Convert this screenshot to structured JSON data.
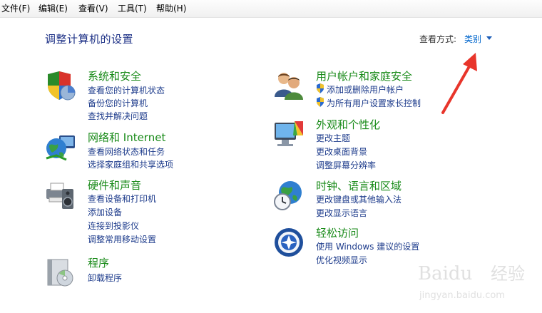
{
  "menu": {
    "file": "文件(F)",
    "edit": "编辑(E)",
    "view": "查看(V)",
    "tools": "工具(T)",
    "help": "帮助(H)"
  },
  "page": {
    "title": "调整计算机的设置",
    "view_by_label": "查看方式:",
    "view_by_value": "类别"
  },
  "categories": {
    "system": {
      "title": "系统和安全",
      "icon": "shield-chart-icon",
      "links": [
        "查看您的计算机状态",
        "备份您的计算机",
        "查找并解决问题"
      ]
    },
    "network": {
      "title": "网络和 Internet",
      "icon": "globe-network-icon",
      "links": [
        "查看网络状态和任务",
        "选择家庭组和共享选项"
      ]
    },
    "hardware": {
      "title": "硬件和声音",
      "icon": "printer-speaker-icon",
      "links": [
        "查看设备和打印机",
        "添加设备",
        "连接到投影仪",
        "调整常用移动设置"
      ]
    },
    "programs": {
      "title": "程序",
      "icon": "programs-disc-icon",
      "links": [
        "卸载程序"
      ]
    },
    "users": {
      "title": "用户帐户和家庭安全",
      "icon": "users-icon",
      "links": [
        "添加或删除用户帐户",
        "为所有用户设置家长控制"
      ]
    },
    "appearance": {
      "title": "外观和个性化",
      "icon": "monitor-paint-icon",
      "links": [
        "更改主题",
        "更改桌面背景",
        "调整屏幕分辨率"
      ]
    },
    "clock": {
      "title": "时钟、语言和区域",
      "icon": "globe-clock-icon",
      "links": [
        "更改键盘或其他输入法",
        "更改显示语言"
      ]
    },
    "ease": {
      "title": "轻松访问",
      "icon": "accessibility-icon",
      "links": [
        "使用 Windows 建议的设置",
        "优化视频显示"
      ]
    }
  },
  "watermark": {
    "brand": "Baidu",
    "cn": "经验",
    "url": "jingyan.baidu.com"
  },
  "colors": {
    "title_blue": "#1e3287",
    "category_green": "#188a18",
    "link_blue": "#1e3c8c",
    "annotation_red": "#e8352b"
  }
}
